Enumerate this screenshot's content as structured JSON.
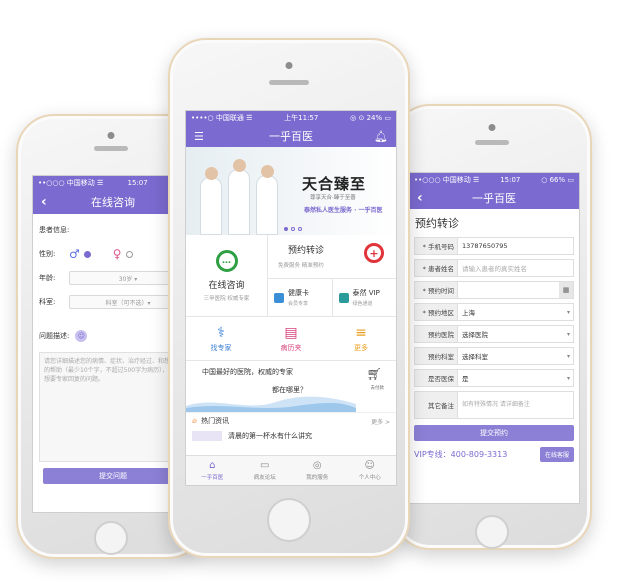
{
  "colors": {
    "accent": "#7b6ad0",
    "green": "#2ea043",
    "red": "#e0343a",
    "orange": "#f07b1e"
  },
  "left_phone": {
    "status": {
      "carrier": "••○○○ 中国移动 ☰",
      "time": "15:07",
      "battery": "○ ▮▮"
    },
    "nav_title": "在线咨询",
    "patient_info_label": "患者信息:",
    "gender_label": "性别:",
    "age_label": "年龄:",
    "age_value": "30岁 ▾",
    "dept_label": "科室:",
    "dept_value": "科室（可不选）▾",
    "question_label": "问题描述:",
    "question_placeholder": "请您详细描述您的病情、症状、治疗经过、和想获得的帮助（最少10个字，不超过500字为病历），以及想要专家回复的问题。",
    "submit_label": "提交问题"
  },
  "center_phone": {
    "status": {
      "carrier": "••••○ 中国联通 ☰",
      "time": "上午11:57",
      "battery": "◎ ⊙ 24% ▭"
    },
    "nav_title": "一乎百医",
    "banner_main": "天合臻至",
    "banner_sub": "尊享天合·臻于至善",
    "banner_slogan": "泰然私人医生服务 · 一乎百医",
    "service_left_title": "在线咨询",
    "service_left_sub": "三甲医院  权威专家",
    "service_top_title": "预约转诊",
    "service_top_sub": "免费服务  精准预约",
    "health_card_title": "健康卡",
    "health_card_sub": "会员专享",
    "vip_title": "泰然 VIP",
    "vip_sub": "绿色通道",
    "quick_items": [
      {
        "label": "找专家",
        "icon": "doctor-icon"
      },
      {
        "label": "病历夹",
        "icon": "record-icon"
      },
      {
        "label": "更多",
        "icon": "more-icon"
      }
    ],
    "ad_line1": "中国最好的医院，权威的专家",
    "ad_line2": "都在哪里？",
    "ad_cart_label": "去付款",
    "news_header": "热门资讯",
    "news_more": "更多 >",
    "news_item": "清晨的第一杯水有什么讲究",
    "tabs": [
      {
        "label": "一乎百医",
        "icon": "home-icon"
      },
      {
        "label": "病友论坛",
        "icon": "forum-icon"
      },
      {
        "label": "我的服务",
        "icon": "service-icon"
      },
      {
        "label": "个人中心",
        "icon": "user-icon"
      }
    ]
  },
  "right_phone": {
    "status": {
      "carrier": "••○○○ 中国移动 ☰",
      "time": "15:07",
      "battery": "○ 66% ▭"
    },
    "nav_title": "一乎百医",
    "page_title": "预约转诊",
    "fields": [
      {
        "label": "* 手机号码",
        "value": "13787650795",
        "placeholder": false,
        "control": ""
      },
      {
        "label": "* 患者姓名",
        "value": "请输入患者的真实姓名",
        "placeholder": true,
        "control": ""
      },
      {
        "label": "* 预约时间",
        "value": "",
        "placeholder": false,
        "control": "calendar"
      },
      {
        "label": "* 预约地区",
        "value": "上海",
        "placeholder": false,
        "control": "caret"
      },
      {
        "label": "预约医院",
        "value": "选择医院",
        "placeholder": false,
        "control": "caret"
      },
      {
        "label": "预约科室",
        "value": "选择科室",
        "placeholder": false,
        "control": "caret"
      },
      {
        "label": "是否医保",
        "value": "是",
        "placeholder": false,
        "control": "caret"
      }
    ],
    "other_label": "其它备注",
    "other_placeholder": "如有特殊情况 请详细备注",
    "submit_label": "提交预约",
    "vip_hotline": "VIP专线：400-809-3313",
    "service_button": "在线客服"
  }
}
